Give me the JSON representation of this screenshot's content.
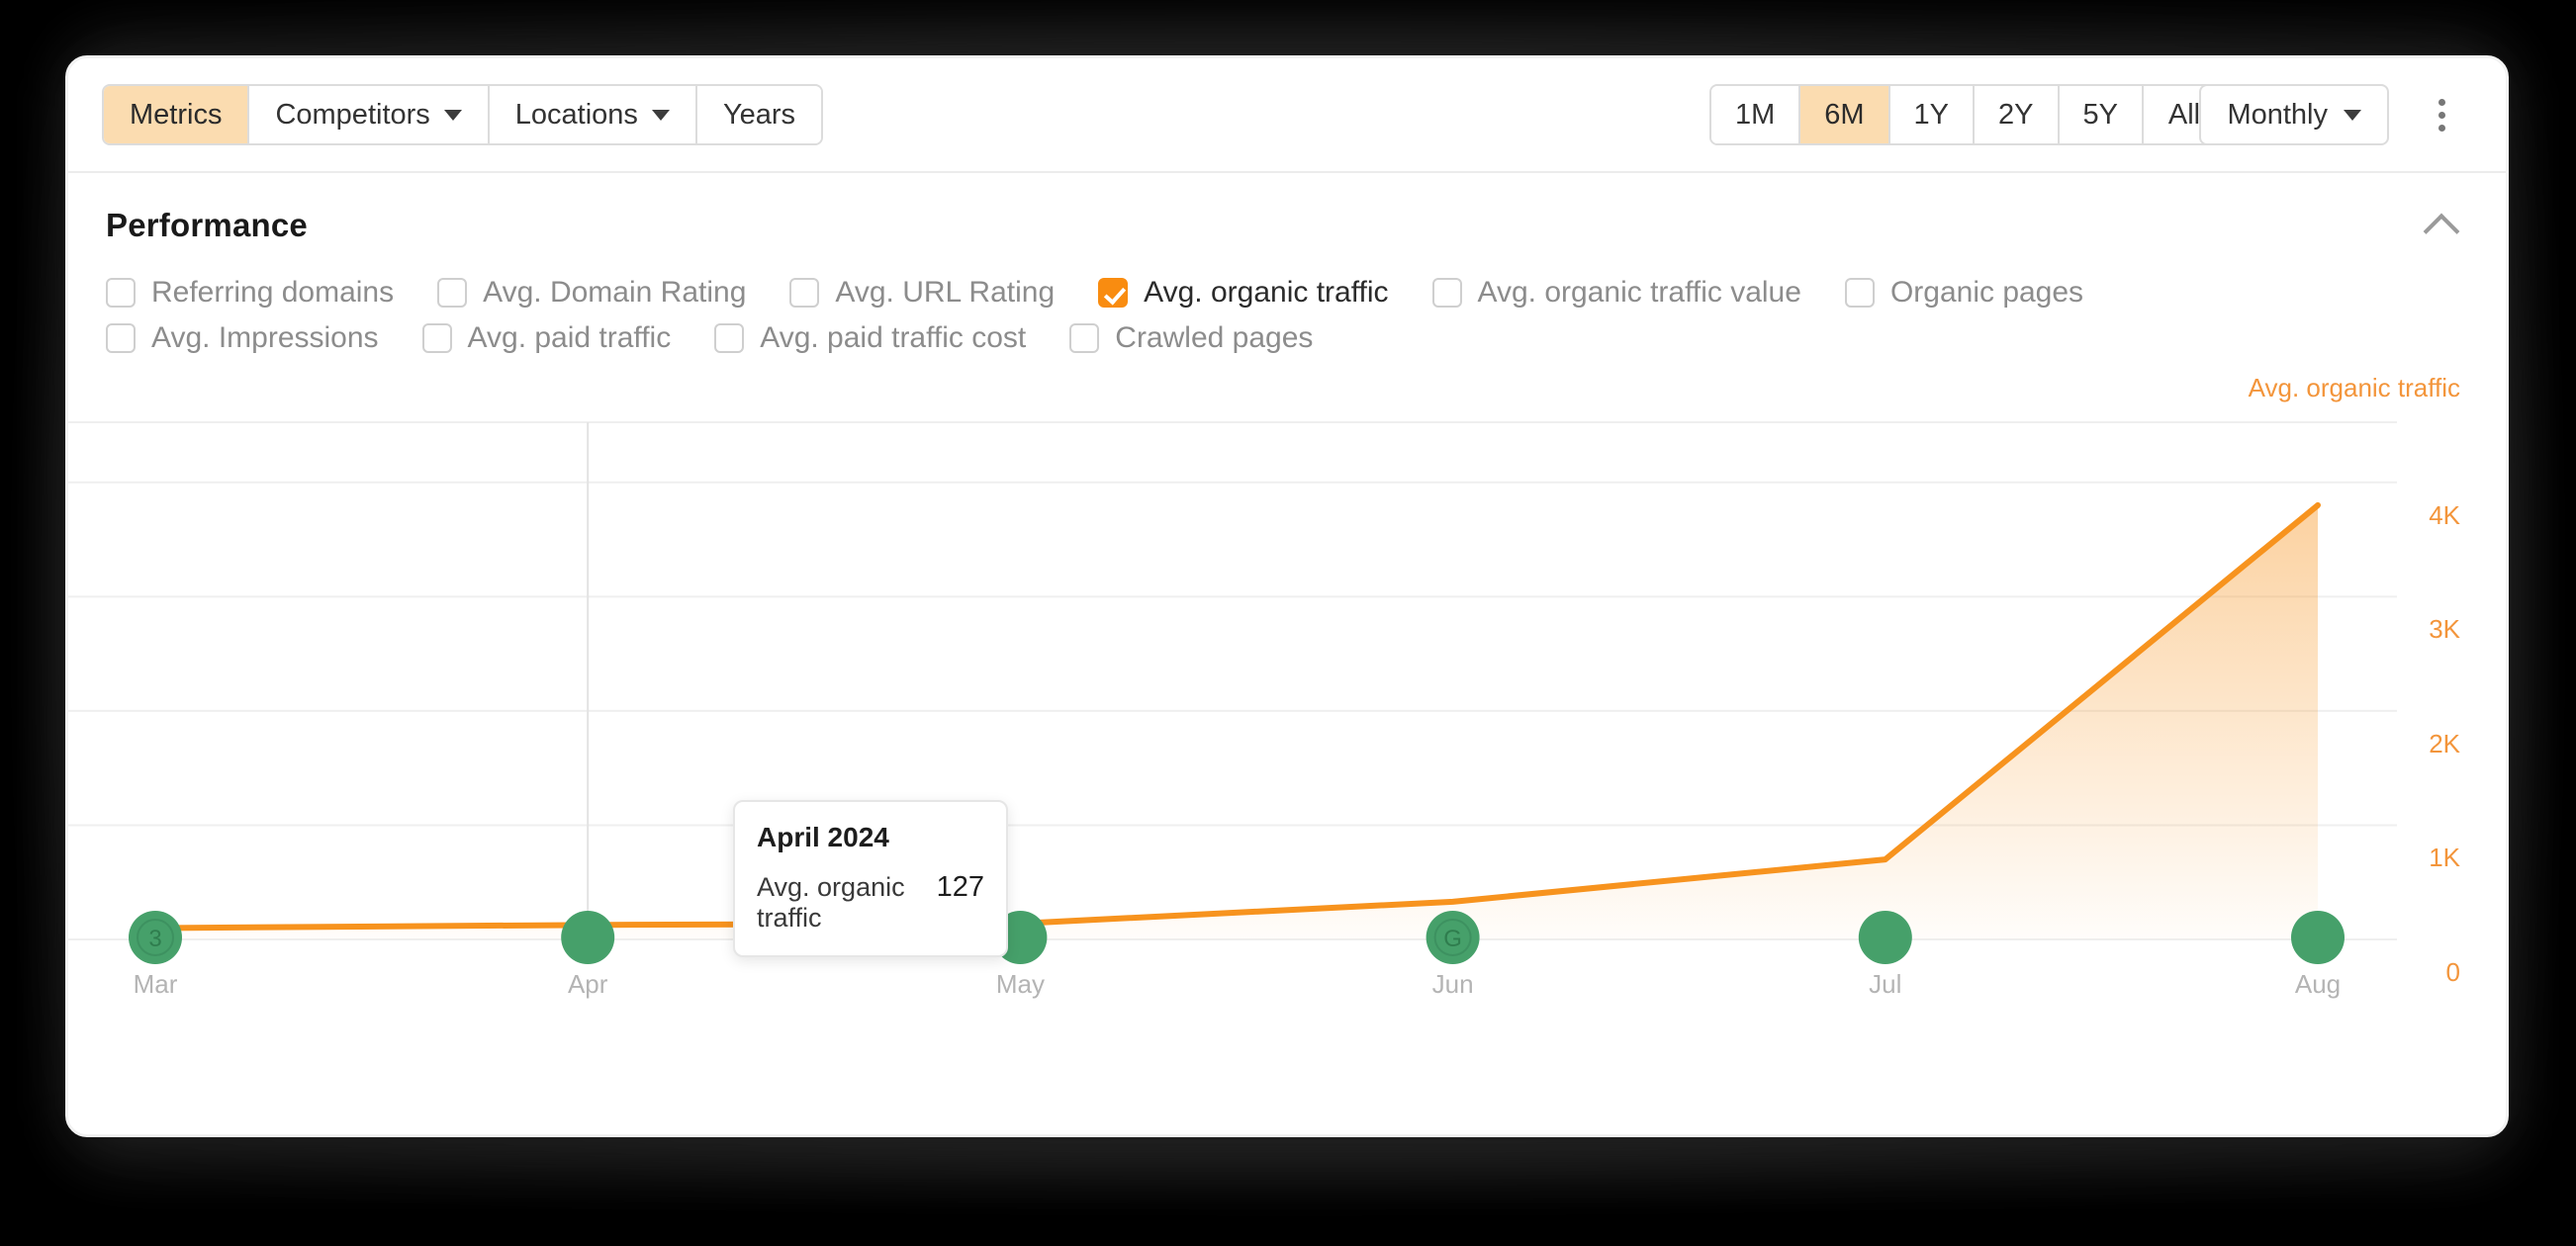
{
  "toolbar": {
    "left_tabs": [
      {
        "label": "Metrics",
        "active": true,
        "caret": false
      },
      {
        "label": "Competitors",
        "active": false,
        "caret": true
      },
      {
        "label": "Locations",
        "active": false,
        "caret": true
      },
      {
        "label": "Years",
        "active": false,
        "caret": false
      }
    ],
    "ranges": [
      {
        "label": "1M",
        "active": false
      },
      {
        "label": "6M",
        "active": true
      },
      {
        "label": "1Y",
        "active": false
      },
      {
        "label": "2Y",
        "active": false
      },
      {
        "label": "5Y",
        "active": false
      },
      {
        "label": "All",
        "active": false
      }
    ],
    "granularity": "Monthly",
    "more_menu": "more-options"
  },
  "section": {
    "title": "Performance",
    "collapse_icon": "chevron-up-icon"
  },
  "metrics": {
    "row1": [
      {
        "label": "Referring domains",
        "checked": false
      },
      {
        "label": "Avg. Domain Rating",
        "checked": false
      },
      {
        "label": "Avg. URL Rating",
        "checked": false
      },
      {
        "label": "Avg. organic traffic",
        "checked": true
      },
      {
        "label": "Avg. organic traffic value",
        "checked": false
      },
      {
        "label": "Organic pages",
        "checked": false
      }
    ],
    "row2": [
      {
        "label": "Avg. Impressions",
        "checked": false
      },
      {
        "label": "Avg. paid traffic",
        "checked": false
      },
      {
        "label": "Avg. paid traffic cost",
        "checked": false
      },
      {
        "label": "Crawled pages",
        "checked": false
      }
    ]
  },
  "tooltip": {
    "title": "April 2024",
    "metric_label": "Avg. organic traffic",
    "metric_value": "127"
  },
  "colors": {
    "accent_orange": "#f98c10",
    "line_orange": "#f7931e",
    "tab_active_bg": "#fbdcb0",
    "marker_green": "#46a06a",
    "tick_gray": "#b4b4b4"
  },
  "chart_data": {
    "type": "area",
    "title": "",
    "series_label": "Avg. organic traffic",
    "xlabel": "",
    "ylabel": "Avg. organic traffic",
    "categories": [
      "Mar",
      "Apr",
      "May",
      "Jun",
      "Jul",
      "Aug"
    ],
    "values": [
      100,
      127,
      140,
      330,
      700,
      3800
    ],
    "ylim": [
      0,
      4500
    ],
    "yticks": [
      "0",
      "1K",
      "2K",
      "3K",
      "4K"
    ],
    "ytick_values": [
      0,
      1000,
      2000,
      3000,
      4000
    ],
    "grid": true,
    "legend_position": "top-right",
    "annotations": [
      {
        "x": "Mar",
        "marker": "green-circle",
        "glyph": "3"
      },
      {
        "x": "Apr",
        "marker": "green-circle",
        "glyph": ""
      },
      {
        "x": "May",
        "marker": "green-circle",
        "glyph": ""
      },
      {
        "x": "Jun",
        "marker": "green-circle",
        "glyph": "G"
      },
      {
        "x": "Jul",
        "marker": "green-circle",
        "glyph": ""
      },
      {
        "x": "Aug",
        "marker": "green-circle",
        "glyph": ""
      }
    ],
    "crosshair_at": "Apr",
    "hover_point": {
      "category": "April 2024",
      "value": 127
    }
  }
}
